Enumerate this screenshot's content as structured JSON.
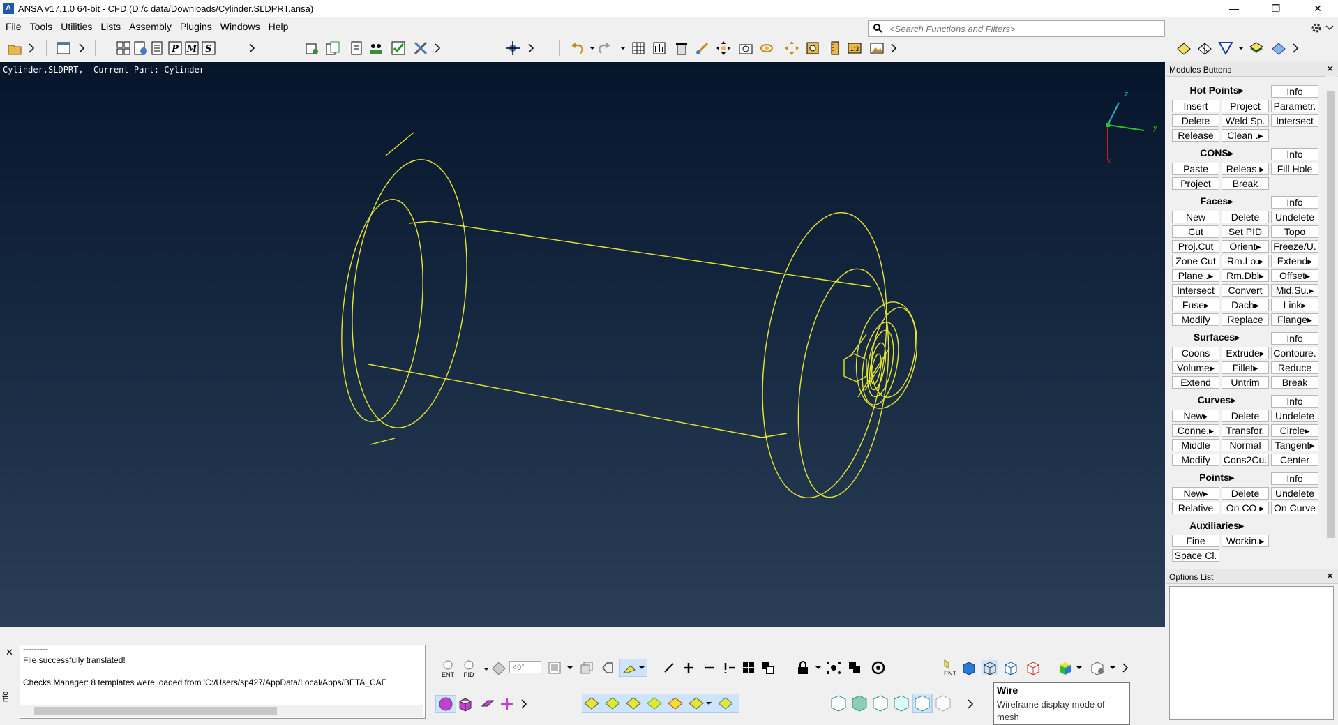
{
  "window": {
    "title": "ANSA v17.1.0 64-bit - CFD (D:/c data/Downloads/Cylinder.SLDPRT.ansa)",
    "app_icon_letter": "A",
    "minimize": "—",
    "restore": "❐",
    "close": "✕"
  },
  "menu": [
    "File",
    "Tools",
    "Utilities",
    "Lists",
    "Assembly",
    "Plugins",
    "Windows",
    "Help"
  ],
  "search": {
    "placeholder": "<Search Functions and Filters>"
  },
  "viewport": {
    "status": "Cylinder.SLDPRT,  Current Part: Cylinder",
    "axis": {
      "z": "z",
      "y": "y",
      "x": "x"
    }
  },
  "modules_panel": {
    "title": "Modules Buttons",
    "close": "✕",
    "sections": {
      "hot_points": {
        "title": "Hot Points▸",
        "info": "Info",
        "buttons": [
          "Insert",
          "Project",
          "Parametr.",
          "Delete",
          "Weld Sp.",
          "Intersect",
          "Release",
          "Clean .▸"
        ]
      },
      "cons": {
        "title": "CONS▸",
        "info": "Info",
        "buttons": [
          "Paste",
          "Releas.▸",
          "Fill Hole",
          "Project",
          "Break"
        ]
      },
      "faces": {
        "title": "Faces▸",
        "info": "Info",
        "buttons": [
          "New",
          "Delete",
          "Undelete",
          "Cut",
          "Set PID",
          "Topo",
          "Proj.Cut",
          "Orient▸",
          "Freeze/U.",
          "Zone Cut",
          "Rm.Lo.▸",
          "Extend▸",
          "Plane .▸",
          "Rm.Dbl▸",
          "Offset▸",
          "Intersect",
          "Convert",
          "Mid.Su.▸",
          "Fuse▸",
          "Dach▸",
          "Link▸",
          "Modify",
          "Replace",
          "Flange▸"
        ]
      },
      "surfaces": {
        "title": "Surfaces▸",
        "info": "Info",
        "buttons": [
          "Coons",
          "Extrude▸",
          "Contoure.",
          "Volume▸",
          "Fillet▸",
          "Reduce",
          "Extend",
          "Untrim",
          "Break"
        ]
      },
      "curves": {
        "title": "Curves▸",
        "info": "Info",
        "buttons": [
          "New▸",
          "Delete",
          "Undelete",
          "Conne.▸",
          "Transfor.",
          "Circle▸",
          "Middle",
          "Normal",
          "Tangent▸",
          "Modify",
          "Cons2Cu.",
          "Center"
        ]
      },
      "points": {
        "title": "Points▸",
        "info": "Info",
        "buttons": [
          "New▸",
          "Delete",
          "Undelete",
          "Relative",
          "On CO.▸",
          "On Curve"
        ]
      },
      "auxiliaries": {
        "title": "Auxiliaries▸",
        "buttons": [
          "Fine",
          "Workin.▸",
          "Space Cl."
        ]
      }
    }
  },
  "options_panel": {
    "title": "Options List",
    "close": "✕"
  },
  "info_panel": {
    "close": "✕",
    "side_label": "Info",
    "lines": [
      "---------",
      "File successfully translated!",
      "Checks Manager: 8 templates were loaded from 'C:/Users/sp427/AppData/Local/Apps/BETA_CAE"
    ]
  },
  "bottom_toolbar": {
    "angle_value": "40°",
    "ent_label": "ENT",
    "pid_label": "PID"
  },
  "tooltip": {
    "title": "Wire",
    "description": "Wireframe display mode of mesh"
  },
  "colors": {
    "wireframe": "#e6e632",
    "viewport_top": "#07152b",
    "viewport_bottom": "#2a3e57"
  }
}
